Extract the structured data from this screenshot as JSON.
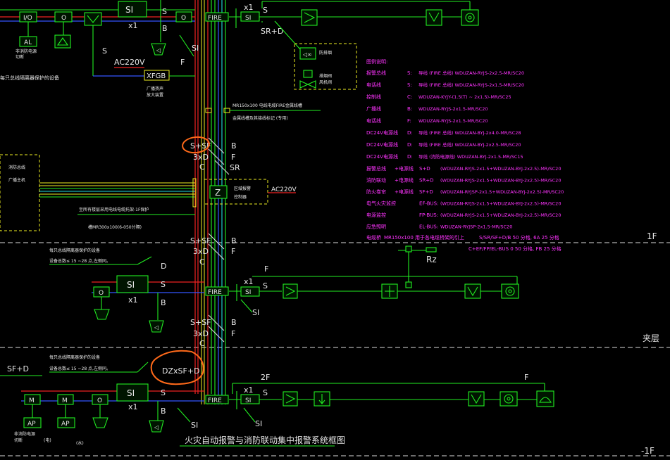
{
  "labels": {
    "si": "SI",
    "o": "O",
    "io": "I/O",
    "al": "AL",
    "m": "M",
    "ap": "AP",
    "z": "Z",
    "xfgb": "XFGB",
    "fire": "FIRE",
    "rz": "Rz",
    "x1": "x1"
  },
  "wire_letters": {
    "s": "S",
    "b": "B",
    "f": "F",
    "c": "C",
    "d": "D",
    "sr": "SR",
    "sr_d": "SR+D",
    "s_sf": "S+SF",
    "x3d": "3xD",
    "sf_d": "SF+D",
    "x2f": "2F",
    "ac220v": "AC220V",
    "dz_sf_d": "DZxSF+D"
  },
  "floors": {
    "f1": "1F",
    "interlayer": "夹层",
    "b1": "-1F"
  },
  "title": "火灾自动报警与消防联动集中报警系统框图",
  "annotations": {
    "guangbo_a": "广播扬声",
    "guangbo_b": "放大装置",
    "fan_a": "防排烟",
    "fan_b": "风机",
    "valve_a": "排烟阀",
    "valve_b": "风机阀",
    "panel_a": "消防总线",
    "panel_b": "广播主机",
    "z_a": "区域报警",
    "z_b": "控制器",
    "note1": "每只总线隔离器保护的设备",
    "note2": "设备总数≤ 15 ~28 点,左侧同。",
    "bus_note": "MR150x100 电线电缆FIRE金属线槽",
    "bus_note2": "金属线槽及其接线标记 (专用)",
    "bridge_note": "至所有楼层采用电线电缆托架-1F保护",
    "bridge_note2": "槽MR300x100(6-050分隔)",
    "emerg_a": "非消防电源",
    "emerg_b": "切断",
    "col1": "(电)",
    "col2": "(水)"
  },
  "legend": {
    "header": "图例说明:",
    "rows": [
      {
        "name": "报警总线",
        "code": "S:",
        "desc": "导线 (FIRE 总线) WDUZAN-RYJS-2x2.5-MR/SC20"
      },
      {
        "name": "电话线",
        "code": "S:",
        "desc": "导线 (FIRE 总线) WDUZAN-RYJS-2x1.5-MR/SC20"
      },
      {
        "name": "控制线",
        "code": "C:",
        "desc": "WDUZAN-KYJY-(1.5(T) ~ 2x1.5)-MR/SC25"
      },
      {
        "name": "广播线",
        "code": "B:",
        "desc": "WDUZAN-RYJS-2x1.5-MR/SC20"
      },
      {
        "name": "电话线",
        "code": "F:",
        "desc": "WDUZAN-RYJS-2x1.5-MR/SC20"
      },
      {
        "name": "DC24V电源线",
        "code": "D:",
        "desc": "导线 (FIRE 总线) WDUZAN-BYJ-2x4.0-MR/SC28"
      },
      {
        "name": "DC24V电源线",
        "code": "D:",
        "desc": "导线 (FIRE 总线) WDUZAN-BYJ-2x2.5-MR/SC20"
      },
      {
        "name": "DC24V电源线",
        "code": "D:",
        "desc": "导线 (消防电源线) WDUZAN-BYJ-2x1.5-MR/SC15"
      }
    ],
    "rows2": [
      {
        "name": "报警总线",
        "tag": "+电源线",
        "code": "S+D",
        "desc": "(WDUZAN-RYJS-2x1.5+WDUZAN-BYJ-2x2.5)-MR/SC20"
      },
      {
        "name": "消防联动",
        "tag": "+电源线",
        "code": "SR+D",
        "desc": "(WDUZAN-RYJS-2x1.5+WDUZAN-BYJ-2x2.5)-MR/SC20"
      },
      {
        "name": "防火卷帘",
        "tag": "+电源线",
        "code": "SF+D",
        "desc": "(WDUZAN-RYJSP-2x1.5+WDUZAN-BYJ-2x2.5)-MR/SC20"
      },
      {
        "name": "电气火灾监控",
        "tag": "",
        "code": "EF-BUS:",
        "desc": "(WDUZAN-RYJS-2x1.5+WDUZAN-BYJ-2x2.5)-MR/SC20"
      },
      {
        "name": "电源监控",
        "tag": "",
        "code": "FP-BUS:",
        "desc": "(WDUZAN-RYJS-2x1.5+WDUZAN-BYJ-2x2.5)-MR/SC20"
      },
      {
        "name": "应急照明",
        "tag": "",
        "code": "EL-BUS:",
        "desc": "WDUZAN-RYJSP-2x1.5-MR/SC20"
      }
    ],
    "trunk_name": "电缆桥",
    "trunk_desc": "MR150x100 用于各电缆桥架的引上",
    "trunk_right": "S/SR/SF+D/B 50 分格,  6A 25 分格",
    "trunk_right2": "C+EF/FP/EL-BUS 0 50 分格,   FB 25 分格"
  }
}
